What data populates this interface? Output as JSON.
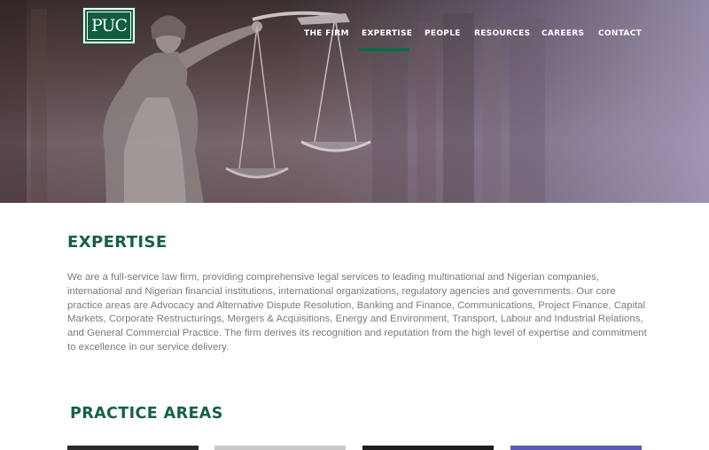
{
  "brand": {
    "logo_text": "PUC"
  },
  "nav": {
    "items": [
      {
        "label": "THE FIRM",
        "active": false
      },
      {
        "label": "EXPERTISE",
        "active": true
      },
      {
        "label": "PEOPLE",
        "active": false
      },
      {
        "label": "RESOURCES",
        "active": false
      },
      {
        "label": "CAREERS",
        "active": false
      },
      {
        "label": "CONTACT",
        "active": false
      }
    ]
  },
  "main": {
    "title": "EXPERTISE",
    "intro": "We are a full-service law firm, providing comprehensive legal services to leading multinational and Nigerian companies, international and Nigerian financial institutions, international organizations, regulatory agencies and governments. Our core practice areas are Advocacy and Alternative Dispute Resolution, Banking and Finance, Communications, Project Finance, Capital Markets, Corporate Restructurings, Mergers & Acquisitions, Energy and Environment, Transport, Labour and Industrial Relations, and General Commercial Practice. The firm derives its recognition and reputation from the high level of expertise and commitment to excellence in our service delivery.",
    "practice_title": "PRACTICE AREAS"
  },
  "colors": {
    "brand_green": "#0f5e3e",
    "heading_green": "#14633f",
    "body_text": "#7b7b7b"
  },
  "icons": {
    "hero": "lady-justice-scales-image"
  }
}
